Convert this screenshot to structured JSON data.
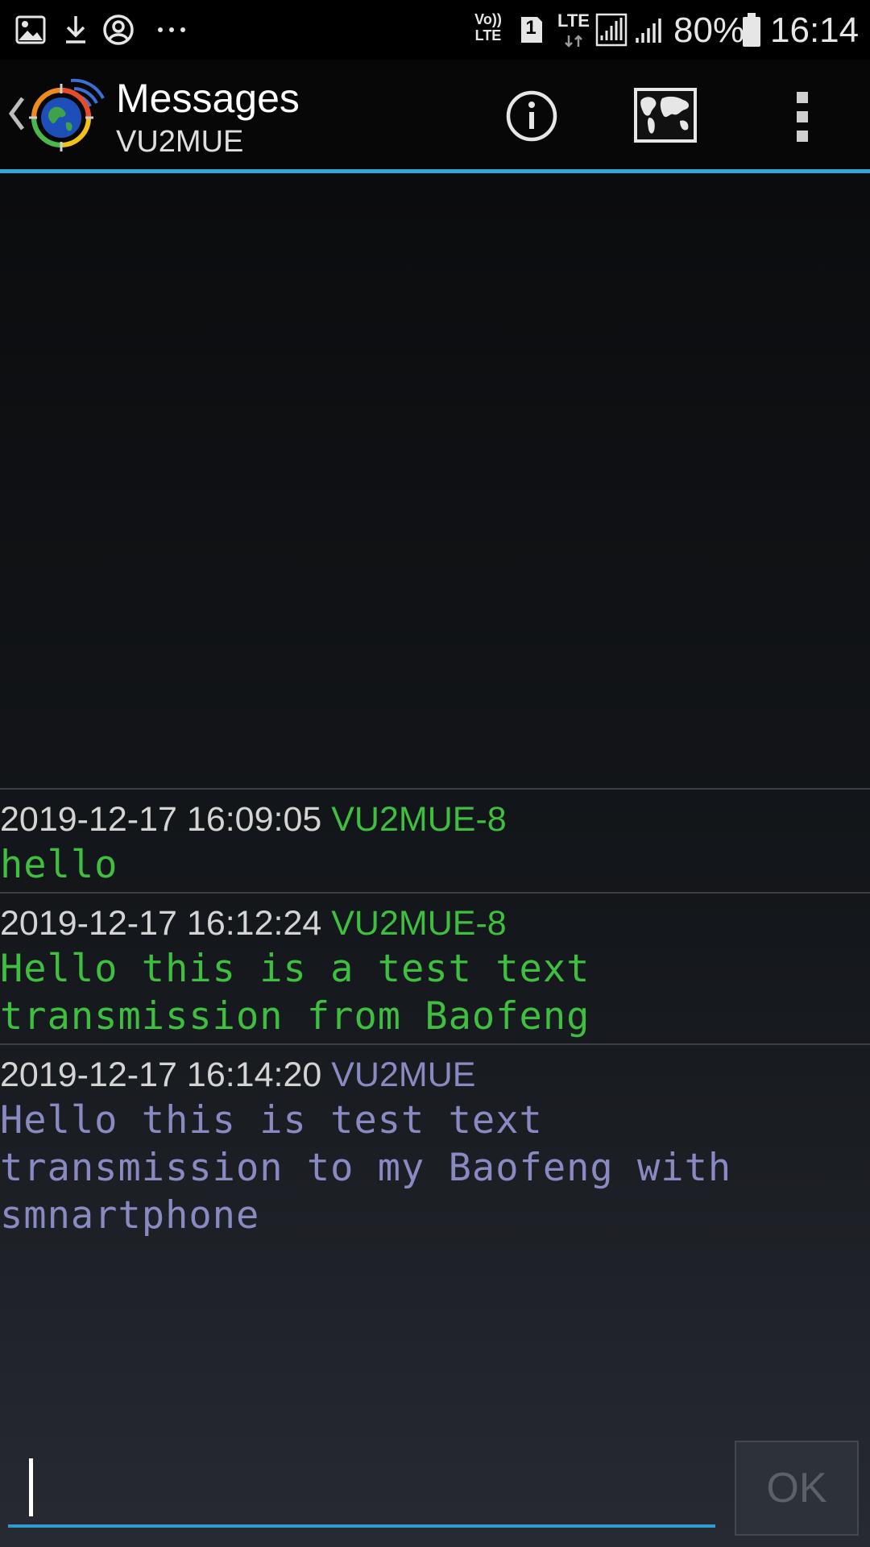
{
  "status_bar": {
    "volte_top": "Vo))",
    "volte_bottom": "LTE",
    "sim_slot": "1",
    "network_type": "LTE",
    "battery_percent": "80%",
    "time": "16:14",
    "icons": [
      "gallery-icon",
      "download-icon",
      "account-icon",
      "more-notifications-icon",
      "volte-icon",
      "sim-icon",
      "signal-icon",
      "battery-icon"
    ]
  },
  "action_bar": {
    "title": "Messages",
    "subtitle": "VU2MUE",
    "icons": [
      "back-icon",
      "app-logo-icon",
      "info-icon",
      "map-icon",
      "overflow-menu-icon"
    ]
  },
  "messages": [
    {
      "timestamp": "2019-12-17 16:09:05",
      "callsign": "VU2MUE-8",
      "text": "hello",
      "color": "#3fbf3f"
    },
    {
      "timestamp": "2019-12-17 16:12:24",
      "callsign": "VU2MUE-8",
      "text": "Hello this is a test text\ntransmission from Baofeng",
      "color": "#3fbf3f"
    },
    {
      "timestamp": "2019-12-17 16:14:20",
      "callsign": "VU2MUE",
      "text": "Hello this is test text\ntransmission to my Baofeng with\nsmnartphone",
      "color": "#8a8ac2"
    }
  ],
  "composer": {
    "input_value": "",
    "ok_label": "OK"
  },
  "colors": {
    "accent": "#33a6d8",
    "received": "#3fbf3f",
    "sent": "#8a8ac2"
  }
}
